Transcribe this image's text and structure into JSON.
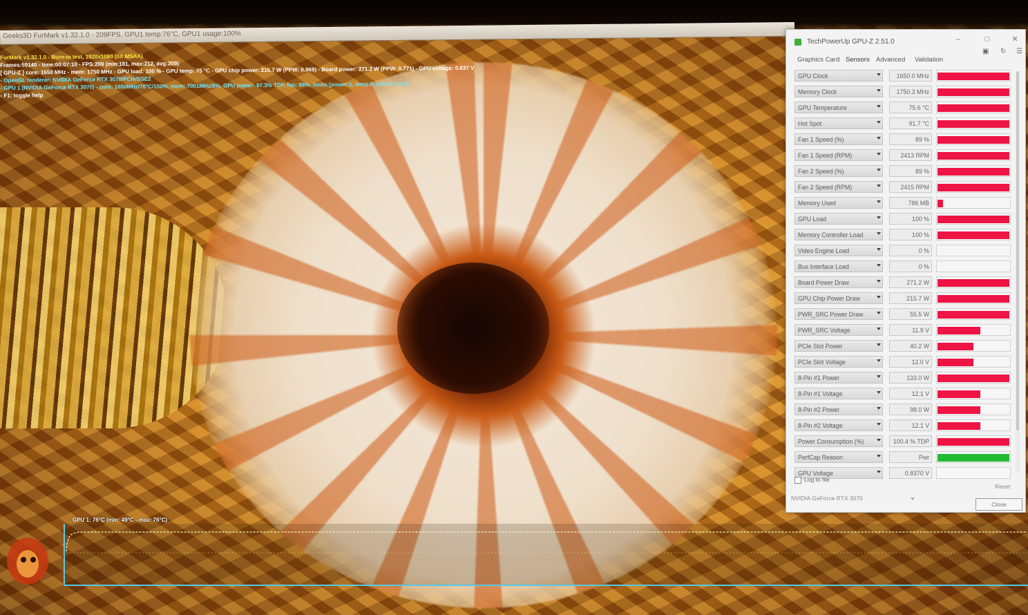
{
  "furmark": {
    "title": "Geeks3D FurMark v1.32.1.0 - 209FPS, GPU1 temp:76°C, GPU1 usage:100%",
    "overlay": [
      {
        "text": "FurMark v1.32.1.0 - Burn-in test, 1920x1080 (0X MSAA)",
        "color": "yellow"
      },
      {
        "text": "Frames:59140 - time:00:07:10 - FPS:209 (min:181, max:212, avg:209)",
        "color": "white"
      },
      {
        "text": "[ GPU-Z ] core: 1650 MHz - mem: 1750 MHz - GPU load: 100 % - GPU temp: 75 °C - GPU chip power: 215.7 W (PPW: 0.969) - Board power: 271.2 W (PPW: 0.771) - GPU voltage: 0.837 V",
        "color": "white"
      },
      {
        "text": "- OpenGL renderer: NVIDIA GeForce RTX 3070/PCIe/SSE2",
        "color": "cyan"
      },
      {
        "text": "- GPU 1 (NVIDIA GeForce RTX 3070) - core: 1650MHz/76°C/100%, mem: 7001MHz/8%, GPU power: 97.3% TDP, fan: 89%, limits:[power:1, temp:0, volt:0, OV:0]",
        "color": "cyan"
      },
      {
        "text": "- F1: toggle help",
        "color": "white"
      }
    ],
    "graph_label": "GPU 1: 76°C (min: 49°C - max: 76°C)"
  },
  "gpuz": {
    "title": "TechPowerUp GPU-Z 2.51.0",
    "tabs": [
      "Graphics Card",
      "Sensors",
      "Advanced",
      "Validation"
    ],
    "active_tab": "Sensors",
    "sensors": [
      {
        "name": "GPU Clock",
        "value": "1650.0 MHz",
        "level": 1.0
      },
      {
        "name": "Memory Clock",
        "value": "1750.3 MHz",
        "level": 1.0
      },
      {
        "name": "GPU Temperature",
        "value": "75.6 °C",
        "level": 1.0
      },
      {
        "name": "Hot Spot",
        "value": "91.7 °C",
        "level": 1.0
      },
      {
        "name": "Fan 1 Speed (%)",
        "value": "89 %",
        "level": 1.0
      },
      {
        "name": "Fan 1 Speed (RPM)",
        "value": "2413 RPM",
        "level": 1.0
      },
      {
        "name": "Fan 2 Speed (%)",
        "value": "89 %",
        "level": 1.0
      },
      {
        "name": "Fan 2 Speed (RPM)",
        "value": "2415 RPM",
        "level": 1.0
      },
      {
        "name": "Memory Used",
        "value": "786 MB",
        "level": 0.08
      },
      {
        "name": "GPU Load",
        "value": "100 %",
        "level": 1.0
      },
      {
        "name": "Memory Controller Load",
        "value": "100 %",
        "level": 1.0
      },
      {
        "name": "Video Engine Load",
        "value": "0 %",
        "level": 0.0
      },
      {
        "name": "Bus Interface Load",
        "value": "0 %",
        "level": 0.0
      },
      {
        "name": "Board Power Draw",
        "value": "271.2 W",
        "level": 1.0
      },
      {
        "name": "GPU Chip Power Draw",
        "value": "215.7 W",
        "level": 1.0
      },
      {
        "name": "PWR_SRC Power Draw",
        "value": "55.5 W",
        "level": 1.0
      },
      {
        "name": "PWR_SRC Voltage",
        "value": "11.9 V",
        "level": 0.6
      },
      {
        "name": "PCIe Slot Power",
        "value": "40.2 W",
        "level": 0.5
      },
      {
        "name": "PCIe Slot Voltage",
        "value": "12.0 V",
        "level": 0.5
      },
      {
        "name": "8-Pin #1 Power",
        "value": "133.0 W",
        "level": 1.0
      },
      {
        "name": "8-Pin #1 Voltage",
        "value": "12.1 V",
        "level": 0.6
      },
      {
        "name": "8-Pin #2 Power",
        "value": "98.0 W",
        "level": 0.6
      },
      {
        "name": "8-Pin #2 Voltage",
        "value": "12.1 V",
        "level": 0.6
      },
      {
        "name": "Power Consumption (%)",
        "value": "100.4 % TDP",
        "level": 1.0
      },
      {
        "name": "PerfCap Reason",
        "value": "Pwr",
        "level": 1.0,
        "color": "#22bb33"
      },
      {
        "name": "GPU Voltage",
        "value": "0.8370 V",
        "level": 0.0
      }
    ],
    "log_to_file": "Log to file",
    "reset": "Reset",
    "device": "NVIDIA GeForce RTX 3070",
    "close": "Close",
    "bar_color": "#ee1444"
  }
}
